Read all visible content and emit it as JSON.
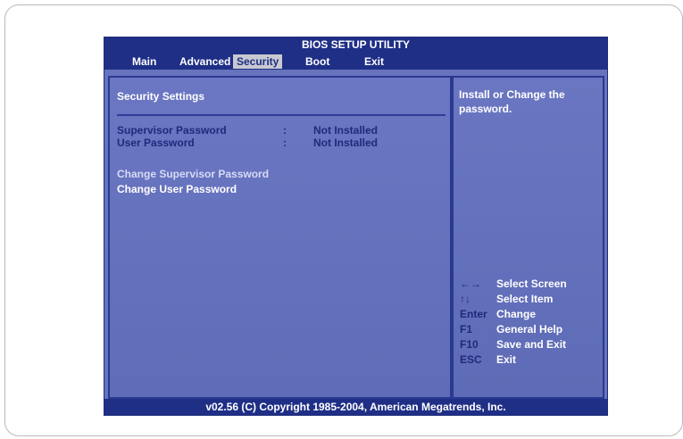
{
  "title": "BIOS SETUP UTILITY",
  "tabs": [
    {
      "label": "Main",
      "active": false
    },
    {
      "label": "Advanced",
      "active": false
    },
    {
      "label": "Security",
      "active": true
    },
    {
      "label": "Boot",
      "active": false
    },
    {
      "label": "Exit",
      "active": false
    }
  ],
  "section_title": "Security Settings",
  "settings": [
    {
      "label": "Supervisor Password",
      "sep": ":",
      "value": "Not Installed"
    },
    {
      "label": "User Password",
      "sep": ":",
      "value": "Not Installed"
    }
  ],
  "actions": [
    {
      "label": "Change Supervisor Password",
      "selected": true
    },
    {
      "label": "Change User Password",
      "selected": false
    }
  ],
  "help_text": "Install or Change the password.",
  "help_lines": [
    "Install or Change the",
    "password."
  ],
  "keys": [
    {
      "key": "←→",
      "desc": "Select Screen"
    },
    {
      "key": "↑↓",
      "desc": "Select Item"
    },
    {
      "key": "Enter",
      "desc": "Change"
    },
    {
      "key": "F1",
      "desc": "General Help"
    },
    {
      "key": "F10",
      "desc": "Save and Exit"
    },
    {
      "key": "ESC",
      "desc": "Exit"
    }
  ],
  "footer": "v02.56 (C) Copyright  1985-2004, American Megatrends, Inc.",
  "colors": {
    "header_bg": "#1f2f86",
    "panel_bg": "#6773bc",
    "active_tab_bg": "#c8c9d1",
    "text_dark_blue": "#1f2a7c",
    "text_white": "#ffffff"
  }
}
